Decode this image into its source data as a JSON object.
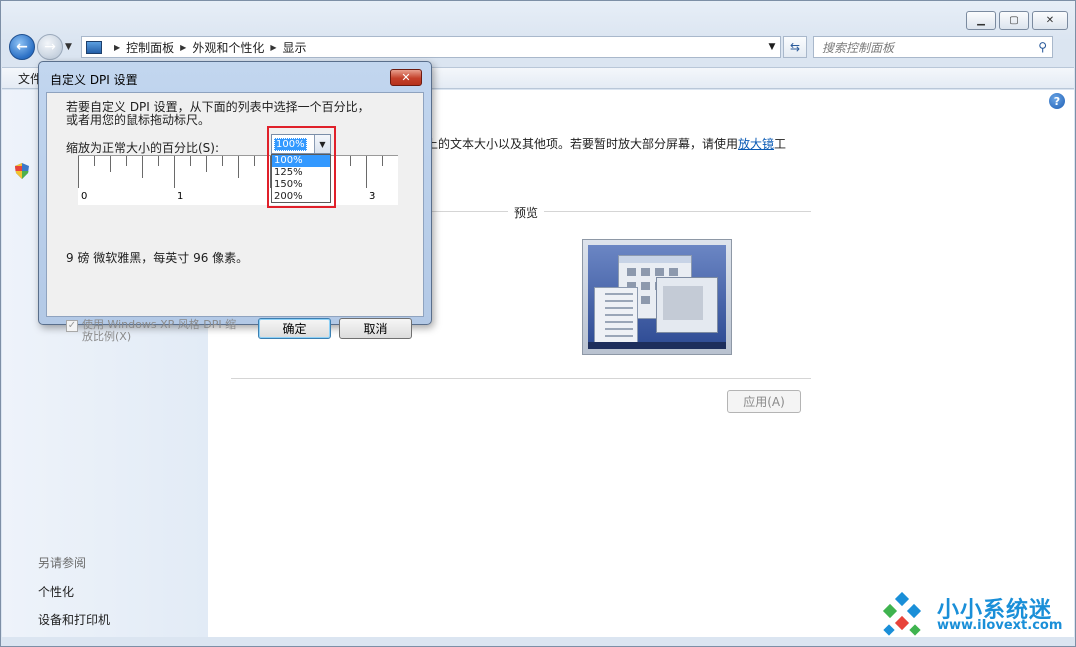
{
  "window": {
    "caption_buttons": [
      "minimize-icon",
      "maximize-icon",
      "close-icon"
    ],
    "address_crumbs": [
      "控制面板",
      "外观和个性化",
      "显示"
    ],
    "search_placeholder": "搜索控制面板",
    "menu_first": "文件"
  },
  "left_pane": {
    "see_also_header": "另请参阅",
    "links": [
      "个性化",
      "设备和打印机"
    ]
  },
  "content": {
    "description_prefix": "上的文本大小以及其他项。若要暂时放大部分屏幕，请使用",
    "magnifier_link": "放大镜",
    "description_suffix": "工",
    "preview_label": "预览",
    "apply_button": "应用(A)"
  },
  "dialog": {
    "title": "自定义 DPI 设置",
    "instruction_line1": "若要自定义 DPI 设置，从下面的列表中选择一个百分比，",
    "instruction_line2": "或者用您的鼠标拖动标尺。",
    "scale_label": "缩放为正常大小的百分比(S):",
    "selected_scale": "100%",
    "scale_options": [
      "100%",
      "125%",
      "150%",
      "200%"
    ],
    "ruler_numbers": [
      "0",
      "1",
      "3"
    ],
    "font_info": "9 磅 微软雅黑，每英寸 96 像素。",
    "xp_checkbox_line1": "使用 Windows XP 风格 DPI 缩",
    "xp_checkbox_line2": "放比例(X)",
    "ok_button": "确定",
    "cancel_button": "取消"
  },
  "watermark": {
    "name": "小小系统迷",
    "url": "www.iIovext.com"
  },
  "colors": {
    "link": "#0b5bb5",
    "selection": "#3399ff",
    "highlight_box": "#e0202a",
    "watermark": "#1a8fd8"
  }
}
